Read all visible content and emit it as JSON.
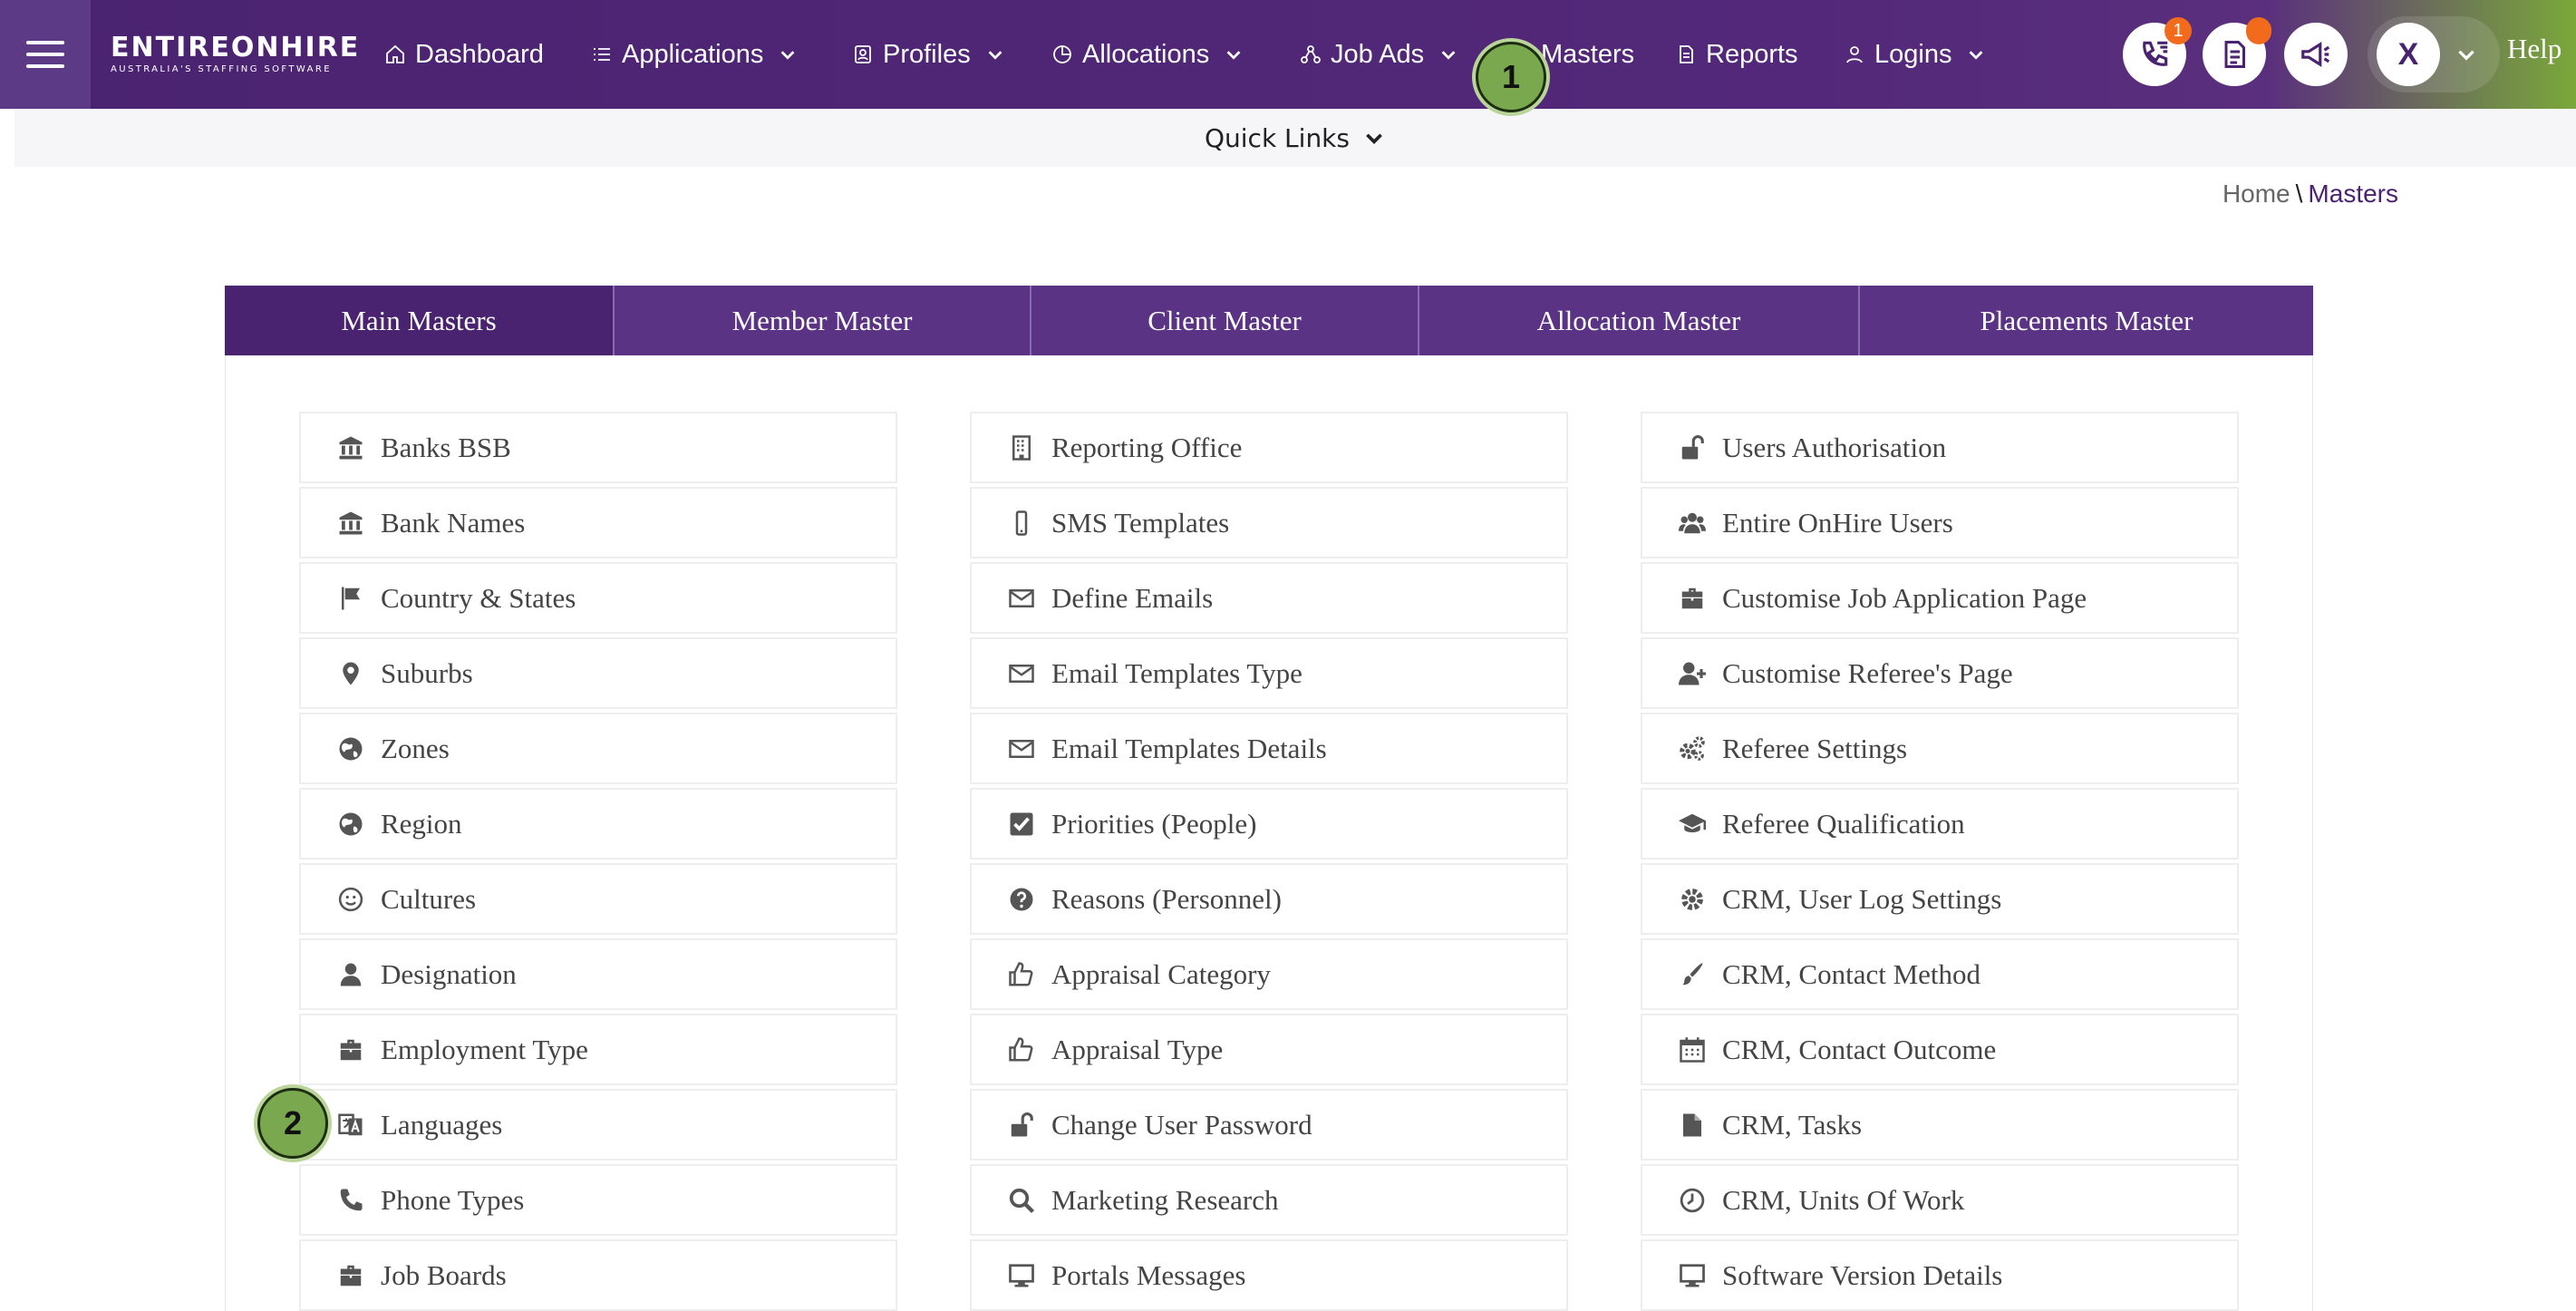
{
  "brand": {
    "name": "ENTIREONHIRE",
    "tagline": "AUSTRALIA'S STAFFING SOFTWARE"
  },
  "nav": {
    "dashboard": "Dashboard",
    "applications": "Applications",
    "profiles": "Profiles",
    "allocations": "Allocations",
    "job_ads": "Job Ads",
    "masters": "Masters",
    "reports": "Reports",
    "logins": "Logins",
    "help": "Help",
    "avatar_initial": "X",
    "calls_badge": "1"
  },
  "quick_links": "Quick Links",
  "breadcrumb": {
    "home": "Home",
    "sep": "\\",
    "current": "Masters"
  },
  "tabs": [
    "Main Masters",
    "Member Master",
    "Client Master",
    "Allocation Master",
    "Placements Master"
  ],
  "columns": {
    "left": [
      {
        "label": "Banks BSB",
        "icon": "bank-icon"
      },
      {
        "label": "Bank Names",
        "icon": "bank-icon"
      },
      {
        "label": "Country & States",
        "icon": "flag-icon"
      },
      {
        "label": "Suburbs",
        "icon": "map-marker-icon"
      },
      {
        "label": "Zones",
        "icon": "globe-icon"
      },
      {
        "label": "Region",
        "icon": "globe-icon"
      },
      {
        "label": "Cultures",
        "icon": "smile-icon"
      },
      {
        "label": "Designation",
        "icon": "user-icon"
      },
      {
        "label": "Employment Type",
        "icon": "briefcase-icon"
      },
      {
        "label": "Languages",
        "icon": "language-icon"
      },
      {
        "label": "Phone Types",
        "icon": "phone-icon"
      },
      {
        "label": "Job Boards",
        "icon": "briefcase-icon"
      }
    ],
    "middle": [
      {
        "label": "Reporting Office",
        "icon": "building-icon"
      },
      {
        "label": "SMS Templates",
        "icon": "mobile-icon"
      },
      {
        "label": "Define Emails",
        "icon": "envelope-icon"
      },
      {
        "label": "Email Templates Type",
        "icon": "envelope-icon"
      },
      {
        "label": "Email Templates Details",
        "icon": "envelope-icon"
      },
      {
        "label": "Priorities (People)",
        "icon": "checkbox-icon"
      },
      {
        "label": "Reasons (Personnel)",
        "icon": "question-icon"
      },
      {
        "label": "Appraisal Category",
        "icon": "thumbs-up-icon"
      },
      {
        "label": "Appraisal Type",
        "icon": "thumbs-up-icon"
      },
      {
        "label": "Change User Password",
        "icon": "unlock-icon"
      },
      {
        "label": "Marketing Research",
        "icon": "search-icon"
      },
      {
        "label": "Portals Messages",
        "icon": "desktop-icon"
      }
    ],
    "right": [
      {
        "label": "Users Authorisation",
        "icon": "unlock-icon"
      },
      {
        "label": "Entire OnHire Users",
        "icon": "users-icon"
      },
      {
        "label": "Customise Job Application Page",
        "icon": "briefcase-icon"
      },
      {
        "label": "Customise Referee's Page",
        "icon": "user-plus-icon"
      },
      {
        "label": "Referee Settings",
        "icon": "cogs-icon"
      },
      {
        "label": "Referee Qualification",
        "icon": "graduation-cap-icon"
      },
      {
        "label": "CRM, User Log Settings",
        "icon": "cog-icon"
      },
      {
        "label": "CRM, Contact Method",
        "icon": "paint-brush-icon"
      },
      {
        "label": "CRM, Contact Outcome",
        "icon": "calendar-icon"
      },
      {
        "label": "CRM, Tasks",
        "icon": "file-icon"
      },
      {
        "label": "CRM, Units Of Work",
        "icon": "clock-icon"
      },
      {
        "label": "Software Version Details",
        "icon": "desktop-icon"
      }
    ]
  },
  "markers": [
    "1",
    "2"
  ],
  "colors": {
    "primary": "#4a2370",
    "tab": "#5a3384",
    "badge": "#f26a1b",
    "marker": "#7aa84e"
  }
}
